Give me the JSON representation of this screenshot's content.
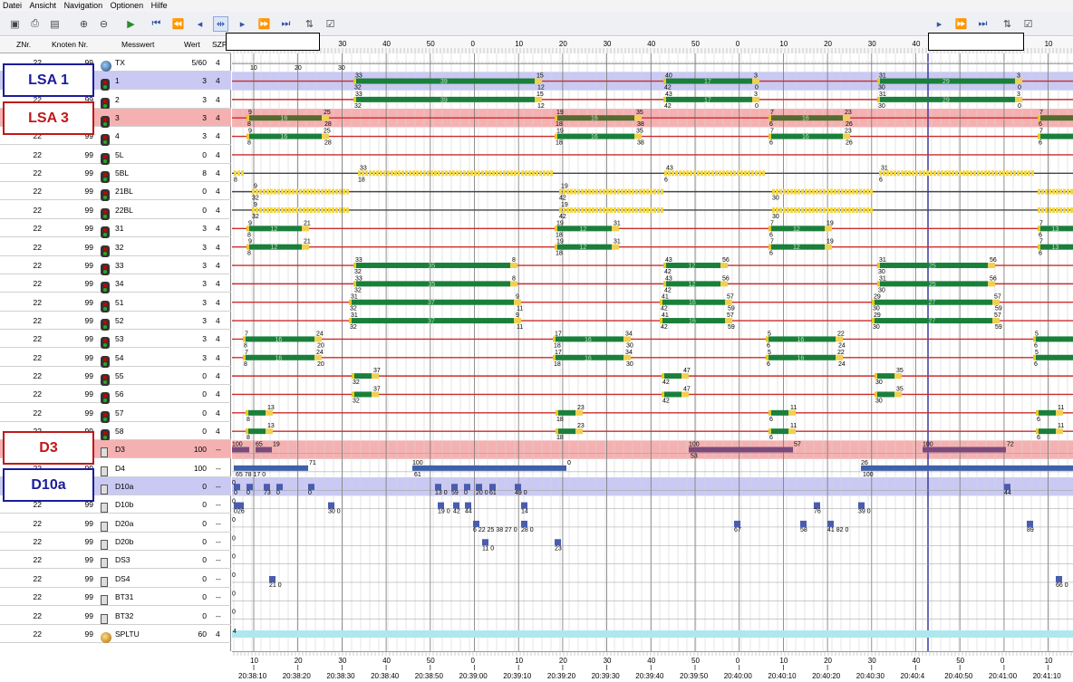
{
  "menu": [
    "Datei",
    "Ansicht",
    "Navigation",
    "Optionen",
    "Hilfe"
  ],
  "columns": {
    "znr": "ZNr.",
    "knoten": "Knoten Nr.",
    "messwert": "Messwert",
    "wert": "Wert",
    "szp": "SZP"
  },
  "rows": [
    {
      "znr": "22",
      "knoten": "99",
      "name": "TX",
      "wert": "5/60",
      "szp": "4",
      "icon": "tx",
      "hl": ""
    },
    {
      "znr": "22",
      "knoten": "99",
      "name": "1",
      "wert": "3",
      "szp": "4",
      "icon": "tl",
      "hl": "blue"
    },
    {
      "znr": "22",
      "knoten": "99",
      "name": "2",
      "wert": "3",
      "szp": "4",
      "icon": "tl",
      "hl": ""
    },
    {
      "znr": "22",
      "knoten": "99",
      "name": "3",
      "wert": "3",
      "szp": "4",
      "icon": "tl",
      "hl": "red"
    },
    {
      "znr": "22",
      "knoten": "99",
      "name": "4",
      "wert": "3",
      "szp": "4",
      "icon": "tl",
      "hl": ""
    },
    {
      "znr": "22",
      "knoten": "99",
      "name": "5L",
      "wert": "0",
      "szp": "4",
      "icon": "tl",
      "hl": ""
    },
    {
      "znr": "22",
      "knoten": "99",
      "name": "5BL",
      "wert": "8",
      "szp": "4",
      "icon": "tl",
      "hl": ""
    },
    {
      "znr": "22",
      "knoten": "99",
      "name": "21BL",
      "wert": "0",
      "szp": "4",
      "icon": "tl",
      "hl": ""
    },
    {
      "znr": "22",
      "knoten": "99",
      "name": "22BL",
      "wert": "0",
      "szp": "4",
      "icon": "tl",
      "hl": ""
    },
    {
      "znr": "22",
      "knoten": "99",
      "name": "31",
      "wert": "3",
      "szp": "4",
      "icon": "tl",
      "hl": ""
    },
    {
      "znr": "22",
      "knoten": "99",
      "name": "32",
      "wert": "3",
      "szp": "4",
      "icon": "tl",
      "hl": ""
    },
    {
      "znr": "22",
      "knoten": "99",
      "name": "33",
      "wert": "3",
      "szp": "4",
      "icon": "tl",
      "hl": ""
    },
    {
      "znr": "22",
      "knoten": "99",
      "name": "34",
      "wert": "3",
      "szp": "4",
      "icon": "tl",
      "hl": ""
    },
    {
      "znr": "22",
      "knoten": "99",
      "name": "51",
      "wert": "3",
      "szp": "4",
      "icon": "tl",
      "hl": ""
    },
    {
      "znr": "22",
      "knoten": "99",
      "name": "52",
      "wert": "3",
      "szp": "4",
      "icon": "tl",
      "hl": ""
    },
    {
      "znr": "22",
      "knoten": "99",
      "name": "53",
      "wert": "3",
      "szp": "4",
      "icon": "tl",
      "hl": ""
    },
    {
      "znr": "22",
      "knoten": "99",
      "name": "54",
      "wert": "3",
      "szp": "4",
      "icon": "tl",
      "hl": ""
    },
    {
      "znr": "22",
      "knoten": "99",
      "name": "55",
      "wert": "0",
      "szp": "4",
      "icon": "tl",
      "hl": ""
    },
    {
      "znr": "22",
      "knoten": "99",
      "name": "56",
      "wert": "0",
      "szp": "4",
      "icon": "tl",
      "hl": ""
    },
    {
      "znr": "22",
      "knoten": "99",
      "name": "57",
      "wert": "0",
      "szp": "4",
      "icon": "tl",
      "hl": ""
    },
    {
      "znr": "22",
      "knoten": "99",
      "name": "58",
      "wert": "0",
      "szp": "4",
      "icon": "tl",
      "hl": ""
    },
    {
      "znr": "22",
      "knoten": "99",
      "name": "D3",
      "wert": "100",
      "szp": "--",
      "icon": "det",
      "hl": "red"
    },
    {
      "znr": "22",
      "knoten": "99",
      "name": "D4",
      "wert": "100",
      "szp": "--",
      "icon": "det",
      "hl": ""
    },
    {
      "znr": "22",
      "knoten": "99",
      "name": "D10a",
      "wert": "0",
      "szp": "--",
      "icon": "det",
      "hl": "blue"
    },
    {
      "znr": "22",
      "knoten": "99",
      "name": "D10b",
      "wert": "0",
      "szp": "--",
      "icon": "det",
      "hl": ""
    },
    {
      "znr": "22",
      "knoten": "99",
      "name": "D20a",
      "wert": "0",
      "szp": "--",
      "icon": "det",
      "hl": ""
    },
    {
      "znr": "22",
      "knoten": "99",
      "name": "D20b",
      "wert": "0",
      "szp": "--",
      "icon": "det",
      "hl": ""
    },
    {
      "znr": "22",
      "knoten": "99",
      "name": "DS3",
      "wert": "0",
      "szp": "--",
      "icon": "det",
      "hl": ""
    },
    {
      "znr": "22",
      "knoten": "99",
      "name": "DS4",
      "wert": "0",
      "szp": "--",
      "icon": "det",
      "hl": ""
    },
    {
      "znr": "22",
      "knoten": "99",
      "name": "BT31",
      "wert": "0",
      "szp": "--",
      "icon": "det",
      "hl": ""
    },
    {
      "znr": "22",
      "knoten": "99",
      "name": "BT32",
      "wert": "0",
      "szp": "--",
      "icon": "det",
      "hl": ""
    },
    {
      "znr": "22",
      "knoten": "99",
      "name": "SPLTU",
      "wert": "60",
      "szp": "4",
      "icon": "sp",
      "hl": ""
    }
  ],
  "labels": {
    "lsa1": "LSA 1",
    "lsa3": "LSA 3",
    "d3": "D3",
    "d10a": "D10a"
  },
  "axis": {
    "top_ticks": [
      "10",
      "20",
      "30",
      "40",
      "50",
      "0",
      "10",
      "20",
      "30",
      "40",
      "50",
      "0",
      "10",
      "20",
      "30",
      "40",
      "50",
      "0",
      "10"
    ],
    "times": [
      "20:38:10",
      "20:38:20",
      "20:38:30",
      "20:38:40",
      "20:38:50",
      "20:39:00",
      "20:39:10",
      "20:39:20",
      "20:39:30",
      "20:39:40",
      "20:39:50",
      "20:40:00",
      "20:40:10",
      "20:40:20",
      "20:40:30",
      "20:40:4",
      "20:40:50",
      "20:41:00",
      "20:41:10"
    ]
  },
  "signals": {
    "1": [
      {
        "s": 390,
        "e": 590,
        "t": "39",
        "a": "33",
        "b": "32",
        "c": "15",
        "d": "12"
      },
      {
        "s": 732,
        "e": 830,
        "t": "17",
        "a": "40",
        "b": "42",
        "c": "3",
        "d": "0"
      },
      {
        "s": 968,
        "e": 1120,
        "t": "29",
        "a": "31",
        "b": "30",
        "c": "3",
        "d": "0"
      }
    ],
    "2": [
      {
        "s": 390,
        "e": 590,
        "t": "39",
        "a": "33",
        "b": "32",
        "c": "15",
        "d": "12"
      },
      {
        "s": 732,
        "e": 830,
        "t": "17",
        "a": "43",
        "b": "42",
        "c": "3",
        "d": "0"
      },
      {
        "s": 968,
        "e": 1120,
        "t": "29",
        "a": "31",
        "b": "30",
        "c": "3",
        "d": "0"
      }
    ],
    "3": [
      {
        "s": 272,
        "e": 355,
        "t": "16",
        "a": "9",
        "b": "8",
        "c": "25",
        "d": "28"
      },
      {
        "s": 612,
        "e": 700,
        "t": "16",
        "a": "19",
        "b": "18",
        "c": "35",
        "d": "38"
      },
      {
        "s": 848,
        "e": 930,
        "t": "16",
        "a": "7",
        "b": "6",
        "c": "23",
        "d": "26"
      },
      {
        "s": 1145,
        "e": 1184,
        "t": "",
        "a": "7",
        "b": "6",
        "c": "",
        "d": ""
      }
    ],
    "4": [
      {
        "s": 272,
        "e": 355,
        "t": "16",
        "a": "9",
        "b": "8",
        "c": "25",
        "d": "28"
      },
      {
        "s": 612,
        "e": 700,
        "t": "16",
        "a": "19",
        "b": "18",
        "c": "35",
        "d": "38"
      },
      {
        "s": 848,
        "e": 930,
        "t": "16",
        "a": "7",
        "b": "6",
        "c": "23",
        "d": "26"
      },
      {
        "s": 1145,
        "e": 1184,
        "t": "",
        "a": "7",
        "b": "6",
        "c": "",
        "d": ""
      }
    ],
    "31": [
      {
        "s": 272,
        "e": 333,
        "t": "12",
        "a": "9",
        "b": "8",
        "c": "21",
        "d": ""
      },
      {
        "s": 612,
        "e": 675,
        "t": "12",
        "a": "19",
        "b": "18",
        "c": "31",
        "d": ""
      },
      {
        "s": 848,
        "e": 910,
        "t": "12",
        "a": "7",
        "b": "6",
        "c": "19",
        "d": ""
      },
      {
        "s": 1145,
        "e": 1184,
        "t": "13",
        "a": "7",
        "b": "6",
        "c": "",
        "d": ""
      }
    ],
    "32": [
      {
        "s": 272,
        "e": 333,
        "t": "12",
        "a": "9",
        "b": "8",
        "c": "21",
        "d": ""
      },
      {
        "s": 612,
        "e": 675,
        "t": "12",
        "a": "19",
        "b": "18",
        "c": "31",
        "d": ""
      },
      {
        "s": 848,
        "e": 910,
        "t": "12",
        "a": "7",
        "b": "6",
        "c": "19",
        "d": ""
      },
      {
        "s": 1145,
        "e": 1184,
        "t": "13",
        "a": "7",
        "b": "6",
        "c": "",
        "d": ""
      }
    ],
    "33": [
      {
        "s": 390,
        "e": 563,
        "t": "35",
        "a": "33",
        "b": "32",
        "c": "8",
        "d": ""
      },
      {
        "s": 732,
        "e": 795,
        "t": "12",
        "a": "43",
        "b": "42",
        "c": "56",
        "d": ""
      },
      {
        "s": 968,
        "e": 1090,
        "t": "25",
        "a": "31",
        "b": "30",
        "c": "56",
        "d": ""
      }
    ],
    "34": [
      {
        "s": 390,
        "e": 563,
        "t": "35",
        "a": "33",
        "b": "32",
        "c": "8",
        "d": ""
      },
      {
        "s": 732,
        "e": 795,
        "t": "12",
        "a": "43",
        "b": "42",
        "c": "56",
        "d": ""
      },
      {
        "s": 968,
        "e": 1090,
        "t": "25",
        "a": "31",
        "b": "30",
        "c": "56",
        "d": ""
      }
    ],
    "51": [
      {
        "s": 385,
        "e": 567,
        "t": "37",
        "a": "31",
        "b": "32",
        "c": "9",
        "d": "11"
      },
      {
        "s": 728,
        "e": 800,
        "t": "16",
        "a": "41",
        "b": "42",
        "c": "57",
        "d": "59"
      },
      {
        "s": 962,
        "e": 1095,
        "t": "27",
        "a": "29",
        "b": "30",
        "c": "57",
        "d": "59"
      }
    ],
    "52": [
      {
        "s": 385,
        "e": 567,
        "t": "37",
        "a": "31",
        "b": "32",
        "c": "9",
        "d": "11"
      },
      {
        "s": 728,
        "e": 800,
        "t": "16",
        "a": "41",
        "b": "42",
        "c": "57",
        "d": "59"
      },
      {
        "s": 962,
        "e": 1095,
        "t": "27",
        "a": "29",
        "b": "30",
        "c": "57",
        "d": "59"
      }
    ],
    "53": [
      {
        "s": 268,
        "e": 347,
        "t": "16",
        "a": "7",
        "b": "8",
        "c": "24",
        "d": "20"
      },
      {
        "s": 610,
        "e": 688,
        "t": "16",
        "a": "17",
        "b": "18",
        "c": "34",
        "d": "30"
      },
      {
        "s": 845,
        "e": 922,
        "t": "16",
        "a": "5",
        "b": "6",
        "c": "22",
        "d": "24"
      },
      {
        "s": 1140,
        "e": 1184,
        "t": "",
        "a": "5",
        "b": "6",
        "c": "",
        "d": ""
      }
    ],
    "54": [
      {
        "s": 268,
        "e": 347,
        "t": "16",
        "a": "7",
        "b": "8",
        "c": "24",
        "d": "20"
      },
      {
        "s": 610,
        "e": 688,
        "t": "16",
        "a": "17",
        "b": "18",
        "c": "34",
        "d": "30"
      },
      {
        "s": 845,
        "e": 922,
        "t": "16",
        "a": "5",
        "b": "6",
        "c": "22",
        "d": "24"
      },
      {
        "s": 1140,
        "e": 1184,
        "t": "",
        "a": "5",
        "b": "6",
        "c": "",
        "d": ""
      }
    ],
    "55": [
      {
        "s": 388,
        "e": 410,
        "t": "",
        "a": "",
        "b": "32",
        "c": "37",
        "d": ""
      },
      {
        "s": 730,
        "e": 752,
        "t": "",
        "a": "",
        "b": "42",
        "c": "47",
        "d": ""
      },
      {
        "s": 965,
        "e": 987,
        "t": "",
        "a": "",
        "b": "30",
        "c": "35",
        "d": ""
      }
    ],
    "56": [
      {
        "s": 388,
        "e": 410,
        "t": "",
        "a": "",
        "b": "32",
        "c": "37",
        "d": ""
      },
      {
        "s": 730,
        "e": 752,
        "t": "",
        "a": "",
        "b": "42",
        "c": "47",
        "d": ""
      },
      {
        "s": 965,
        "e": 987,
        "t": "",
        "a": "",
        "b": "30",
        "c": "35",
        "d": ""
      }
    ],
    "57": [
      {
        "s": 271,
        "e": 293,
        "t": "",
        "a": "",
        "b": "8",
        "c": "13",
        "d": ""
      },
      {
        "s": 613,
        "e": 635,
        "t": "",
        "a": "",
        "b": "18",
        "c": "23",
        "d": ""
      },
      {
        "s": 848,
        "e": 870,
        "t": "",
        "a": "",
        "b": "6",
        "c": "11",
        "d": ""
      },
      {
        "s": 1143,
        "e": 1165,
        "t": "",
        "a": "",
        "b": "6",
        "c": "11",
        "d": ""
      }
    ],
    "58": [
      {
        "s": 271,
        "e": 293,
        "t": "",
        "a": "",
        "b": "8",
        "c": "13",
        "d": ""
      },
      {
        "s": 613,
        "e": 635,
        "t": "",
        "a": "",
        "b": "18",
        "c": "23",
        "d": ""
      },
      {
        "s": 848,
        "e": 870,
        "t": "",
        "a": "",
        "b": "6",
        "c": "11",
        "d": ""
      },
      {
        "s": 1143,
        "e": 1165,
        "t": "",
        "a": "",
        "b": "6",
        "c": "11",
        "d": ""
      }
    ]
  },
  "yellow": {
    "5BL": [
      {
        "s": 258,
        "e": 270,
        "a": "",
        "b": "8"
      },
      {
        "s": 395,
        "e": 610,
        "a": "33",
        "b": "18"
      },
      {
        "s": 733,
        "e": 845,
        "a": "43",
        "b": "6"
      },
      {
        "s": 970,
        "e": 1140,
        "a": "31",
        "b": "6"
      }
    ],
    "21BL": [
      {
        "s": 278,
        "e": 385,
        "a": "9",
        "b": "32"
      },
      {
        "s": 617,
        "e": 730,
        "a": "19",
        "b": "42"
      },
      {
        "s": 852,
        "e": 962,
        "a": "",
        "b": "30"
      },
      {
        "s": 1145,
        "e": 1184,
        "a": "",
        "b": ""
      }
    ],
    "22BL": [
      {
        "s": 278,
        "e": 385,
        "a": "9",
        "b": "32"
      },
      {
        "s": 617,
        "e": 730,
        "a": "19",
        "b": "42"
      },
      {
        "s": 852,
        "e": 962,
        "a": "",
        "b": "30"
      },
      {
        "s": 1145,
        "e": 1184,
        "a": "",
        "b": ""
      }
    ]
  },
  "detbars": {
    "D3": [
      {
        "s": 256,
        "e": 275,
        "a": "100",
        "b": "",
        "c": ""
      },
      {
        "s": 282,
        "e": 300,
        "a": "65",
        "b": "",
        "c": "19"
      },
      {
        "s": 760,
        "e": 875,
        "a": "100",
        "b": "53",
        "c": "57"
      },
      {
        "s": 1018,
        "e": 1110,
        "a": "100",
        "b": "",
        "c": "72"
      }
    ],
    "D4": [
      {
        "s": 258,
        "e": 340,
        "a": "",
        "b": "65 78 17 0",
        "c": "71"
      },
      {
        "s": 455,
        "e": 625,
        "a": "100",
        "b": "61",
        "c": "0"
      },
      {
        "s": 950,
        "e": 1184,
        "a": "26",
        "b": "100",
        "c": "75"
      }
    ]
  },
  "pulses": {
    "D10a": [
      [
        258,
        "0"
      ],
      [
        272,
        "0"
      ],
      [
        291,
        "73"
      ],
      [
        305,
        "0"
      ],
      [
        340,
        "0"
      ],
      [
        480,
        "13 0"
      ],
      [
        498,
        "59"
      ],
      [
        512,
        "0"
      ],
      [
        525,
        "20 0"
      ],
      [
        540,
        "61"
      ],
      [
        568,
        "49 0"
      ],
      [
        1108,
        "44"
      ]
    ],
    "D10b": [
      [
        258,
        "0"
      ],
      [
        262,
        "26"
      ],
      [
        362,
        "30 0"
      ],
      [
        483,
        "19 0"
      ],
      [
        500,
        "42"
      ],
      [
        513,
        "44"
      ],
      [
        575,
        "14"
      ],
      [
        898,
        "76"
      ],
      [
        947,
        "39 0"
      ]
    ],
    "D20a": [
      [
        522,
        "6 22 25 38 27 0"
      ],
      [
        575,
        "28 0"
      ],
      [
        810,
        "67"
      ],
      [
        883,
        "58"
      ],
      [
        913,
        "41 82 0"
      ],
      [
        1133,
        "89"
      ]
    ],
    "D20b": [
      [
        532,
        "11 0"
      ],
      [
        612,
        "23"
      ]
    ],
    "DS3": [],
    "DS4": [
      [
        297,
        "21 0"
      ],
      [
        1165,
        "66 0"
      ]
    ],
    "BT31": [],
    "BT32": []
  }
}
